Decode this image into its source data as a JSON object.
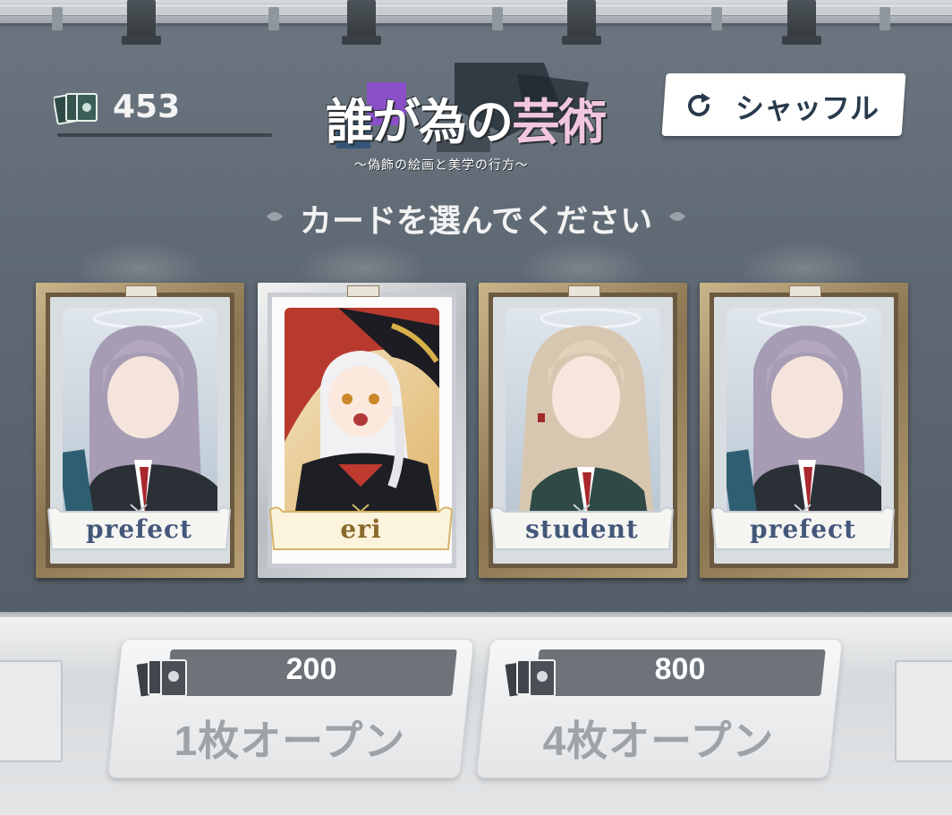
{
  "currency": {
    "value": "453",
    "icon": "card-deck-icon"
  },
  "logo": {
    "title_part1": "誰が為の",
    "title_part2": "芸術",
    "subtitle": "〜偽飾の絵画と美学の行方〜"
  },
  "shuffle": {
    "label": "シャッフル",
    "icon": "refresh-icon"
  },
  "prompt": "カードを選んでください",
  "cards": [
    {
      "label": "prefect",
      "frame": "gold"
    },
    {
      "label": "eri",
      "frame": "silver"
    },
    {
      "label": "student",
      "frame": "gold"
    },
    {
      "label": "prefect",
      "frame": "gold"
    }
  ],
  "open_buttons": [
    {
      "cost": "200",
      "label": "1枚オープン"
    },
    {
      "cost": "800",
      "label": "4枚オープン"
    }
  ],
  "colors": {
    "accent_text": "#2a3a4d",
    "gold_frame": "#b79f74",
    "silver_frame": "#e6e8ea",
    "logo_pink": "#f2c7de"
  }
}
